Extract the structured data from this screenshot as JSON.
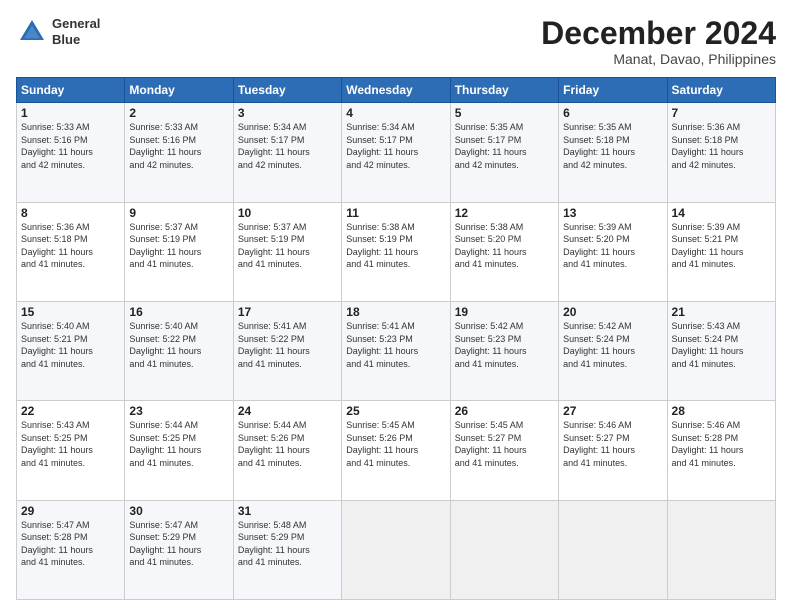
{
  "logo": {
    "line1": "General",
    "line2": "Blue"
  },
  "header": {
    "month": "December 2024",
    "location": "Manat, Davao, Philippines"
  },
  "weekdays": [
    "Sunday",
    "Monday",
    "Tuesday",
    "Wednesday",
    "Thursday",
    "Friday",
    "Saturday"
  ],
  "weeks": [
    [
      {
        "day": "1",
        "info": "Sunrise: 5:33 AM\nSunset: 5:16 PM\nDaylight: 11 hours\nand 42 minutes."
      },
      {
        "day": "2",
        "info": "Sunrise: 5:33 AM\nSunset: 5:16 PM\nDaylight: 11 hours\nand 42 minutes."
      },
      {
        "day": "3",
        "info": "Sunrise: 5:34 AM\nSunset: 5:17 PM\nDaylight: 11 hours\nand 42 minutes."
      },
      {
        "day": "4",
        "info": "Sunrise: 5:34 AM\nSunset: 5:17 PM\nDaylight: 11 hours\nand 42 minutes."
      },
      {
        "day": "5",
        "info": "Sunrise: 5:35 AM\nSunset: 5:17 PM\nDaylight: 11 hours\nand 42 minutes."
      },
      {
        "day": "6",
        "info": "Sunrise: 5:35 AM\nSunset: 5:18 PM\nDaylight: 11 hours\nand 42 minutes."
      },
      {
        "day": "7",
        "info": "Sunrise: 5:36 AM\nSunset: 5:18 PM\nDaylight: 11 hours\nand 42 minutes."
      }
    ],
    [
      {
        "day": "8",
        "info": "Sunrise: 5:36 AM\nSunset: 5:18 PM\nDaylight: 11 hours\nand 41 minutes."
      },
      {
        "day": "9",
        "info": "Sunrise: 5:37 AM\nSunset: 5:19 PM\nDaylight: 11 hours\nand 41 minutes."
      },
      {
        "day": "10",
        "info": "Sunrise: 5:37 AM\nSunset: 5:19 PM\nDaylight: 11 hours\nand 41 minutes."
      },
      {
        "day": "11",
        "info": "Sunrise: 5:38 AM\nSunset: 5:19 PM\nDaylight: 11 hours\nand 41 minutes."
      },
      {
        "day": "12",
        "info": "Sunrise: 5:38 AM\nSunset: 5:20 PM\nDaylight: 11 hours\nand 41 minutes."
      },
      {
        "day": "13",
        "info": "Sunrise: 5:39 AM\nSunset: 5:20 PM\nDaylight: 11 hours\nand 41 minutes."
      },
      {
        "day": "14",
        "info": "Sunrise: 5:39 AM\nSunset: 5:21 PM\nDaylight: 11 hours\nand 41 minutes."
      }
    ],
    [
      {
        "day": "15",
        "info": "Sunrise: 5:40 AM\nSunset: 5:21 PM\nDaylight: 11 hours\nand 41 minutes."
      },
      {
        "day": "16",
        "info": "Sunrise: 5:40 AM\nSunset: 5:22 PM\nDaylight: 11 hours\nand 41 minutes."
      },
      {
        "day": "17",
        "info": "Sunrise: 5:41 AM\nSunset: 5:22 PM\nDaylight: 11 hours\nand 41 minutes."
      },
      {
        "day": "18",
        "info": "Sunrise: 5:41 AM\nSunset: 5:23 PM\nDaylight: 11 hours\nand 41 minutes."
      },
      {
        "day": "19",
        "info": "Sunrise: 5:42 AM\nSunset: 5:23 PM\nDaylight: 11 hours\nand 41 minutes."
      },
      {
        "day": "20",
        "info": "Sunrise: 5:42 AM\nSunset: 5:24 PM\nDaylight: 11 hours\nand 41 minutes."
      },
      {
        "day": "21",
        "info": "Sunrise: 5:43 AM\nSunset: 5:24 PM\nDaylight: 11 hours\nand 41 minutes."
      }
    ],
    [
      {
        "day": "22",
        "info": "Sunrise: 5:43 AM\nSunset: 5:25 PM\nDaylight: 11 hours\nand 41 minutes."
      },
      {
        "day": "23",
        "info": "Sunrise: 5:44 AM\nSunset: 5:25 PM\nDaylight: 11 hours\nand 41 minutes."
      },
      {
        "day": "24",
        "info": "Sunrise: 5:44 AM\nSunset: 5:26 PM\nDaylight: 11 hours\nand 41 minutes."
      },
      {
        "day": "25",
        "info": "Sunrise: 5:45 AM\nSunset: 5:26 PM\nDaylight: 11 hours\nand 41 minutes."
      },
      {
        "day": "26",
        "info": "Sunrise: 5:45 AM\nSunset: 5:27 PM\nDaylight: 11 hours\nand 41 minutes."
      },
      {
        "day": "27",
        "info": "Sunrise: 5:46 AM\nSunset: 5:27 PM\nDaylight: 11 hours\nand 41 minutes."
      },
      {
        "day": "28",
        "info": "Sunrise: 5:46 AM\nSunset: 5:28 PM\nDaylight: 11 hours\nand 41 minutes."
      }
    ],
    [
      {
        "day": "29",
        "info": "Sunrise: 5:47 AM\nSunset: 5:28 PM\nDaylight: 11 hours\nand 41 minutes."
      },
      {
        "day": "30",
        "info": "Sunrise: 5:47 AM\nSunset: 5:29 PM\nDaylight: 11 hours\nand 41 minutes."
      },
      {
        "day": "31",
        "info": "Sunrise: 5:48 AM\nSunset: 5:29 PM\nDaylight: 11 hours\nand 41 minutes."
      },
      {
        "day": "",
        "info": ""
      },
      {
        "day": "",
        "info": ""
      },
      {
        "day": "",
        "info": ""
      },
      {
        "day": "",
        "info": ""
      }
    ]
  ]
}
